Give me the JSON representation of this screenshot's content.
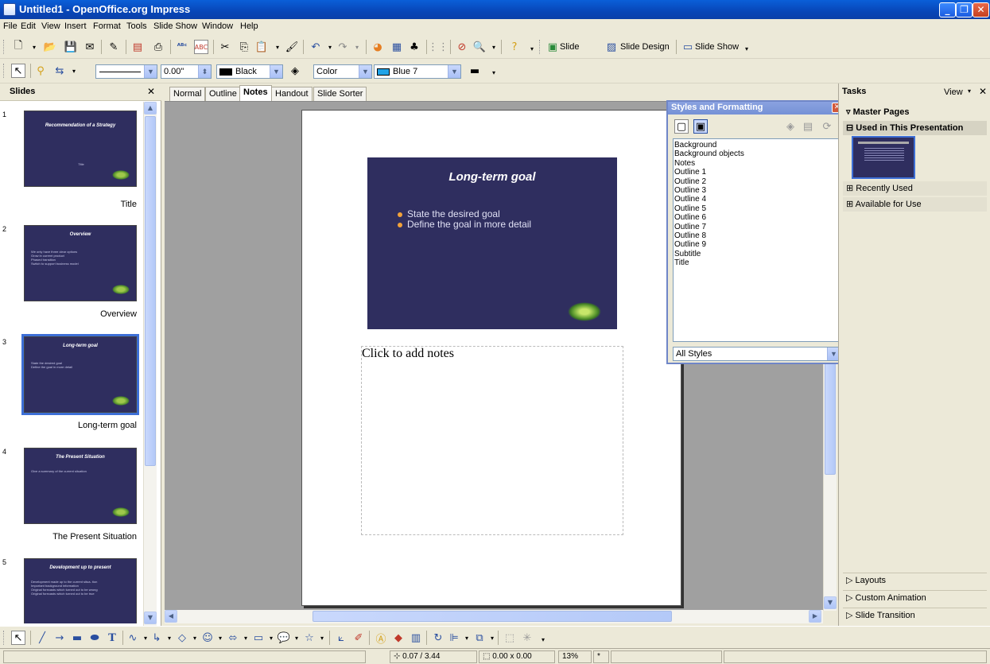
{
  "window": {
    "title": "Untitled1 - OpenOffice.org Impress"
  },
  "menu": [
    "File",
    "Edit",
    "View",
    "Insert",
    "Format",
    "Tools",
    "Slide Show",
    "Window",
    "Help"
  ],
  "toolbar_main": {
    "slide_label": "Slide",
    "slide_design_label": "Slide Design",
    "slide_show_label": "Slide Show"
  },
  "toolbar_line": {
    "line_width": "0.00\"",
    "line_color": "Black",
    "area_style": "Color",
    "area_color": "Blue 7"
  },
  "slides_pane": {
    "title": "Slides",
    "slides": [
      {
        "num": "1",
        "caption": "Title",
        "thumb_title": "Recommendation of a Strategy",
        "thumb_body": [
          "Title"
        ]
      },
      {
        "num": "2",
        "caption": "Overview",
        "thumb_title": "Overview",
        "thumb_body": [
          "We only have three clear options",
          "Grow in current product",
          "Phased transition",
          "Switch to support business model"
        ]
      },
      {
        "num": "3",
        "caption": "Long-term goal",
        "thumb_title": "Long-term goal",
        "thumb_body": [
          "State the desired goal",
          "Define the goal in more detail"
        ]
      },
      {
        "num": "4",
        "caption": "The Present Situation",
        "thumb_title": "The Present Situation",
        "thumb_body": [
          "Give a summary of the current situation"
        ]
      },
      {
        "num": "5",
        "caption": "",
        "thumb_title": "Development up to present",
        "thumb_body": [
          "Development made up to the current situa- tion",
          "Important background information",
          "Original forecasts which turned out to be wrong",
          "Original forecasts which turned out to be true"
        ]
      }
    ]
  },
  "view_tabs": [
    "Normal",
    "Outline",
    "Notes",
    "Handout",
    "Slide Sorter"
  ],
  "active_tab": "Notes",
  "current_slide": {
    "title": "Long-term goal",
    "bullets": [
      "State the desired goal",
      "Define the goal in more detail"
    ],
    "notes_placeholder": "Click to add notes"
  },
  "styles_window": {
    "title": "Styles and Formatting",
    "styles": [
      "Background",
      "Background objects",
      "Notes",
      "Outline 1",
      "Outline 2",
      "Outline 3",
      "Outline 4",
      "Outline 5",
      "Outline 6",
      "Outline 7",
      "Outline 8",
      "Outline 9",
      "Subtitle",
      "Title"
    ],
    "filter": "All Styles"
  },
  "tasks_pane": {
    "title": "Tasks",
    "view_label": "View",
    "master_pages": "Master Pages",
    "used_in_presentation": "Used in This Presentation",
    "recently_used": "Recently Used",
    "available_for_use": "Available for Use",
    "layouts": "Layouts",
    "custom_animation": "Custom Animation",
    "slide_transition": "Slide Transition"
  },
  "statusbar": {
    "position": "0.07 / 3.44",
    "size": "0.00 x 0.00",
    "zoom": "13%",
    "modified": "*"
  },
  "colors": {
    "slide_bg": "#2f2e5f",
    "bullet": "#f2a23a",
    "titlebar": "#0a5fd8"
  }
}
